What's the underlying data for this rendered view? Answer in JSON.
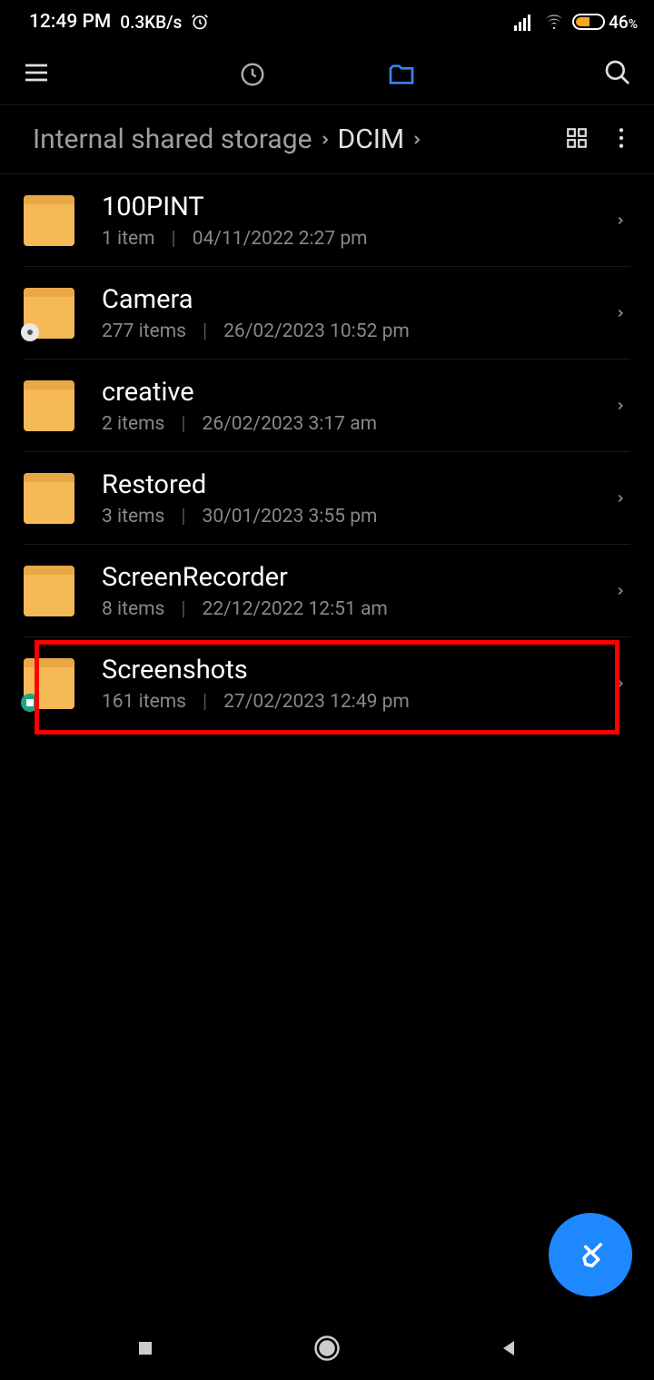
{
  "status": {
    "time": "12:49 PM",
    "speed": "0.3KB/s",
    "battery_pct": "46",
    "battery_suffix": "%"
  },
  "breadcrumb": {
    "root": "Internal shared storage",
    "current": "DCIM"
  },
  "folders": [
    {
      "name": "100PINT",
      "items": "1 item",
      "date": "04/11/2022 2:27 pm",
      "overlay": "none"
    },
    {
      "name": "Camera",
      "items": "277 items",
      "date": "26/02/2023 10:52 pm",
      "overlay": "white"
    },
    {
      "name": "creative",
      "items": "2 items",
      "date": "26/02/2023 3:17 am",
      "overlay": "none"
    },
    {
      "name": "Restored",
      "items": "3 items",
      "date": "30/01/2023 3:55 pm",
      "overlay": "none"
    },
    {
      "name": "ScreenRecorder",
      "items": "8 items",
      "date": "22/12/2022 12:51 am",
      "overlay": "none"
    },
    {
      "name": "Screenshots",
      "items": "161 items",
      "date": "27/02/2023 12:49 pm",
      "overlay": "teal"
    }
  ],
  "highlighted_index": 5
}
